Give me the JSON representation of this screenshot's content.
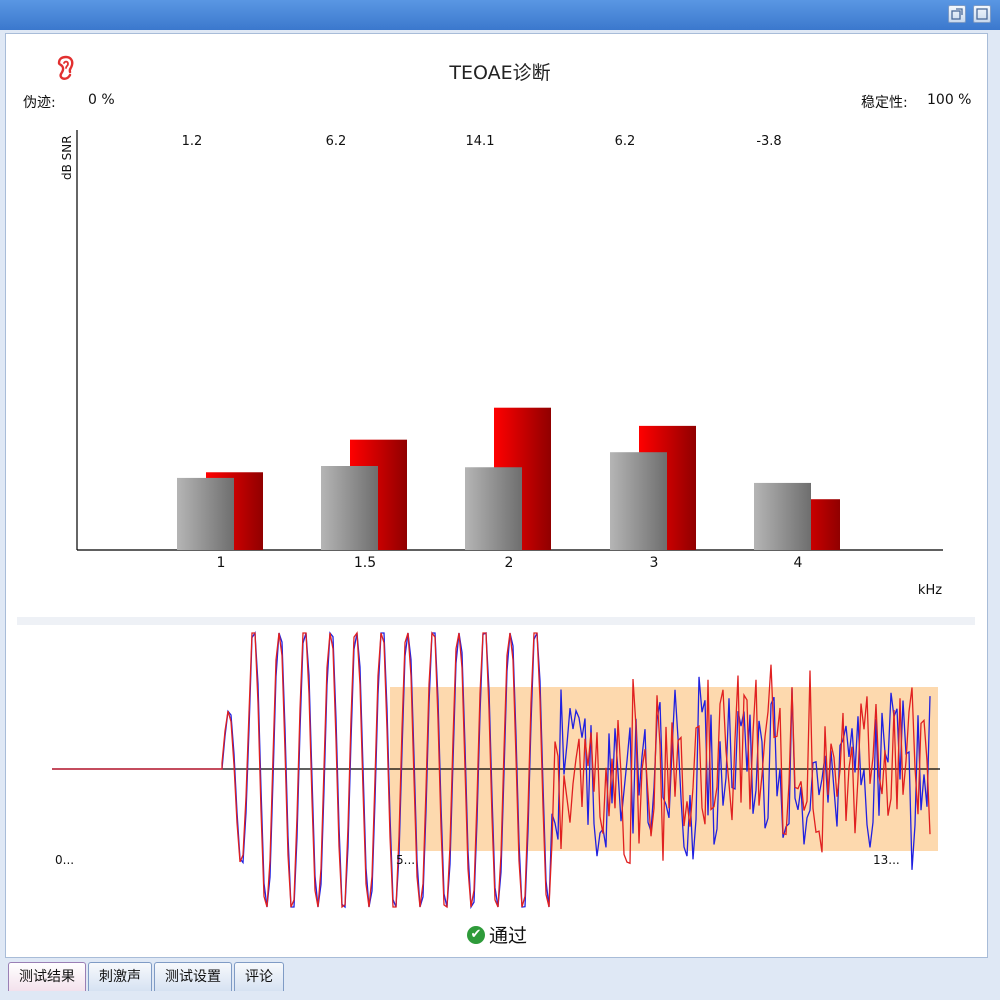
{
  "window": {
    "buttons": [
      "restore-icon",
      "maximize-icon"
    ]
  },
  "header": {
    "title": "TEOAE诊断",
    "artifact_label": "伪迹:",
    "artifact_value": "0 %",
    "stability_label": "稳定性:",
    "stability_value": "100 %",
    "icon": "ear-icon"
  },
  "chart_data": {
    "type": "bar",
    "title": "",
    "xlabel": "kHz",
    "ylabel": "dB SNR",
    "categories": [
      "1",
      "1.5",
      "2",
      "3",
      "4"
    ],
    "snr_labels": [
      "1.2",
      "6.2",
      "14.1",
      "6.2",
      "-3.8"
    ],
    "series": [
      {
        "name": "",
        "color": "#8c8c8c",
        "values": [
          11.5,
          13.4,
          13.2,
          15.6,
          10.7
        ]
      },
      {
        "name": "",
        "color": "#d00000",
        "values": [
          12.4,
          17.6,
          22.7,
          19.8,
          8.1
        ]
      }
    ],
    "ylim": [
      0,
      67
    ]
  },
  "waveform": {
    "x_tick_labels": [
      "0...",
      "5...",
      "13..."
    ],
    "window_color": "#fdd9ae",
    "trace_colors": [
      "#e02020",
      "#2020e0"
    ]
  },
  "result": {
    "status_text": "通过",
    "icon": "check-icon"
  },
  "tabs": [
    {
      "label": "测试结果",
      "active": true
    },
    {
      "label": "刺激声",
      "active": false
    },
    {
      "label": "测试设置",
      "active": false
    },
    {
      "label": "评论",
      "active": false
    }
  ]
}
